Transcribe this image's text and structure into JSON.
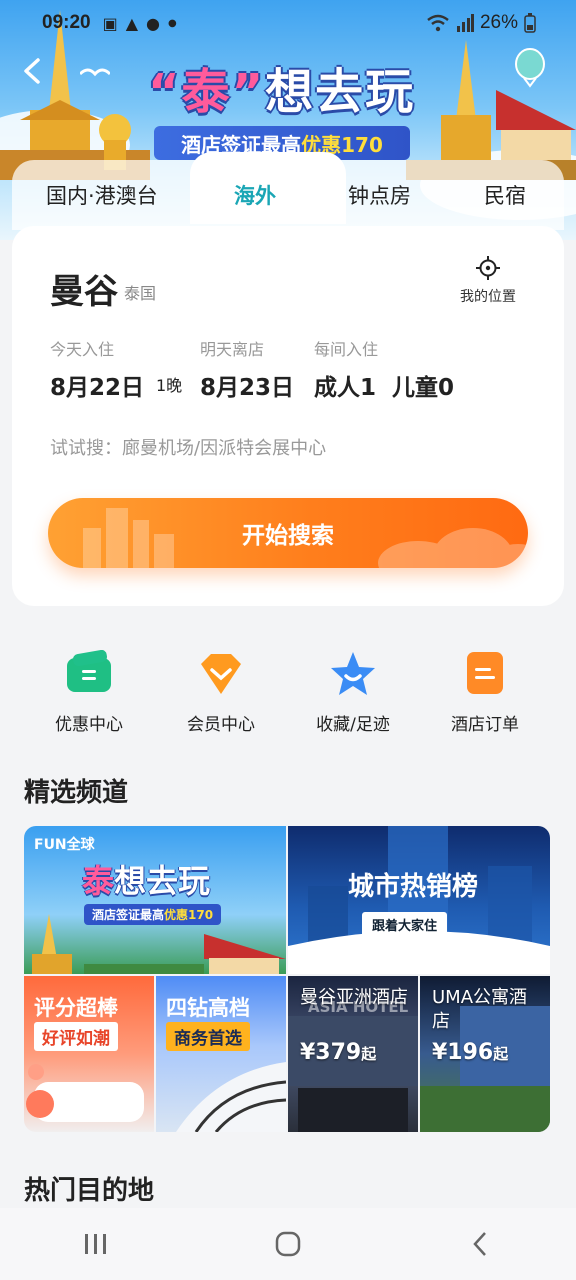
{
  "status_bar": {
    "time": "09:20",
    "battery": "26%"
  },
  "banner": {
    "title_quote_left": "“",
    "title_tai": "泰",
    "title_quote_right": "”",
    "title_rest": "想去玩",
    "subtitle_pre": "酒店签证最高",
    "subtitle_highlight": "优惠170"
  },
  "tabs": [
    {
      "label": "国内·港澳台"
    },
    {
      "label": "海外"
    },
    {
      "label": "钟点房"
    },
    {
      "label": "民宿"
    }
  ],
  "search": {
    "city": "曼谷",
    "country": "泰国",
    "my_location": "我的位置",
    "checkin_label": "今天入住",
    "checkin_date": "8月22日",
    "nights": "1晚",
    "checkout_label": "明天离店",
    "checkout_date": "8月23日",
    "guests_label": "每间入住",
    "adults": "成人1",
    "children": "儿童0",
    "try_search": "试试搜：廊曼机场/因派特会展中心",
    "button": "开始搜索"
  },
  "quick_actions": [
    {
      "label": "优惠中心",
      "icon": "coupon-icon",
      "color": "#1fbf84"
    },
    {
      "label": "会员中心",
      "icon": "diamond-icon",
      "color": "#ff9a1f"
    },
    {
      "label": "收藏/足迹",
      "icon": "star-icon",
      "color": "#3a8cf5"
    },
    {
      "label": "酒店订单",
      "icon": "order-icon",
      "color": "#ff8a26"
    }
  ],
  "channels": {
    "title": "精选频道",
    "thai": {
      "brand": "FUN全球",
      "title_tai": "泰",
      "title_rest": "想去玩",
      "sub_pre": "酒店签证最高",
      "sub_hl": "优惠170"
    },
    "city_hot": {
      "title": "城市热销榜",
      "sub": "跟着大家住"
    },
    "rating": {
      "title": "评分超棒",
      "sub": "好评如潮"
    },
    "business": {
      "title": "四钻高档",
      "sub": "商务首选"
    },
    "hotel1": {
      "name": "曼谷亚洲酒店",
      "price": "¥379",
      "unit": "起",
      "sign": "ASIA HOTEL"
    },
    "hotel2": {
      "name": "UMA公寓酒店",
      "price": "¥196",
      "unit": "起"
    }
  },
  "hot_destinations": {
    "title": "热门目的地"
  }
}
